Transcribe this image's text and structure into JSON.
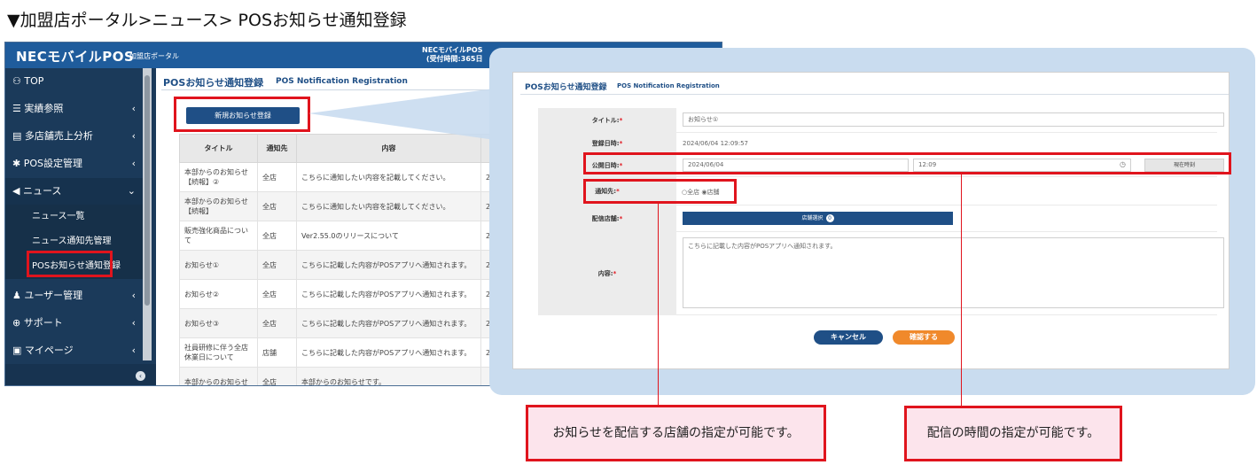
{
  "heading": "▼加盟店ポータル>ニュース> POSお知らせ通知登録",
  "left": {
    "brand": "NECモバイルPOS",
    "brand_sub": "加盟店ポータル",
    "topbar_right_1": "NECモバイルPOS",
    "topbar_right_2": "(受付時間:365日",
    "sidebar": [
      {
        "icon": "dashboard-icon",
        "label": "TOP",
        "chevron": ""
      },
      {
        "icon": "list-icon",
        "label": "実績参照",
        "chevron": "‹"
      },
      {
        "icon": "database-icon",
        "label": "多店舗売上分析",
        "chevron": "‹"
      },
      {
        "icon": "gear-icon",
        "label": "POS設定管理",
        "chevron": "‹"
      },
      {
        "icon": "megaphone-icon",
        "label": "ニュース",
        "chevron": "⌄"
      }
    ],
    "sidebar_sub": [
      "ニュース一覧",
      "ニュース通知先管理",
      "POSお知らせ通知登録"
    ],
    "sidebar_after": [
      {
        "icon": "users-icon",
        "label": "ユーザー管理",
        "chevron": "‹"
      },
      {
        "icon": "support-icon",
        "label": "サポート",
        "chevron": "‹"
      },
      {
        "icon": "id-card-icon",
        "label": "マイページ",
        "chevron": "‹"
      }
    ],
    "page_title": "POSお知らせ通知登録",
    "page_sub": "POS Notification Registration",
    "new_button": "新規お知らせ登録",
    "table": {
      "headers": [
        "タイトル",
        "通知先",
        "内容"
      ],
      "rows": [
        [
          "本部からのお知らせ【続報】②",
          "全店",
          "こちらに通知したい内容を記載してください。"
        ],
        [
          "本部からのお知らせ【続報】",
          "全店",
          "こちらに通知したい内容を記載してください。"
        ],
        [
          "販売強化商品について",
          "全店",
          "Ver2.55.0のリリースについて"
        ],
        [
          "お知らせ①",
          "全店",
          "こちらに記載した内容がPOSアプリへ通知されます。"
        ],
        [
          "お知らせ②",
          "全店",
          "こちらに記載した内容がPOSアプリへ通知されます。"
        ],
        [
          "お知らせ③",
          "全店",
          "こちらに記載した内容がPOSアプリへ通知されます。"
        ],
        [
          "社員研修に伴う全店休業日について",
          "店舗",
          "こちらに記載した内容がPOSアプリへ通知されます。"
        ],
        [
          "本部からのお知らせ",
          "全店",
          "本部からのお知らせです。"
        ]
      ],
      "extra_col_char": "2"
    }
  },
  "form": {
    "title": "POSお知らせ通知登録",
    "sub": "POS Notification Registration",
    "label_title": "タイトル:",
    "value_title": "お知らせ①",
    "label_registered": "登録日時:",
    "value_registered": "2024/06/04 12:09:57",
    "label_publish": "公開日時:",
    "value_publish_date": "2024/06/04",
    "value_publish_time": "12:09",
    "now_button": "現在時刻",
    "label_target": "通知先:",
    "radio_all": "全店",
    "radio_store": "店舗",
    "label_stores": "配信店舗:",
    "store_select_button": "店舗選択",
    "store_count": "0",
    "label_content": "内容:",
    "value_content": "こちらに記載した内容がPOSアプリへ通知されます。",
    "required_mark": "*",
    "cancel_button": "キャンセル",
    "confirm_button": "確認する"
  },
  "callouts": {
    "store": "お知らせを配信する店舗の指定が可能です。",
    "time": "配信の時間の指定が可能です。"
  },
  "colors": {
    "accent_red": "#e0141d",
    "nav_blue": "#1f5c9c",
    "sidebar": "#1b3a5a",
    "confirm_orange": "#f0892b"
  }
}
